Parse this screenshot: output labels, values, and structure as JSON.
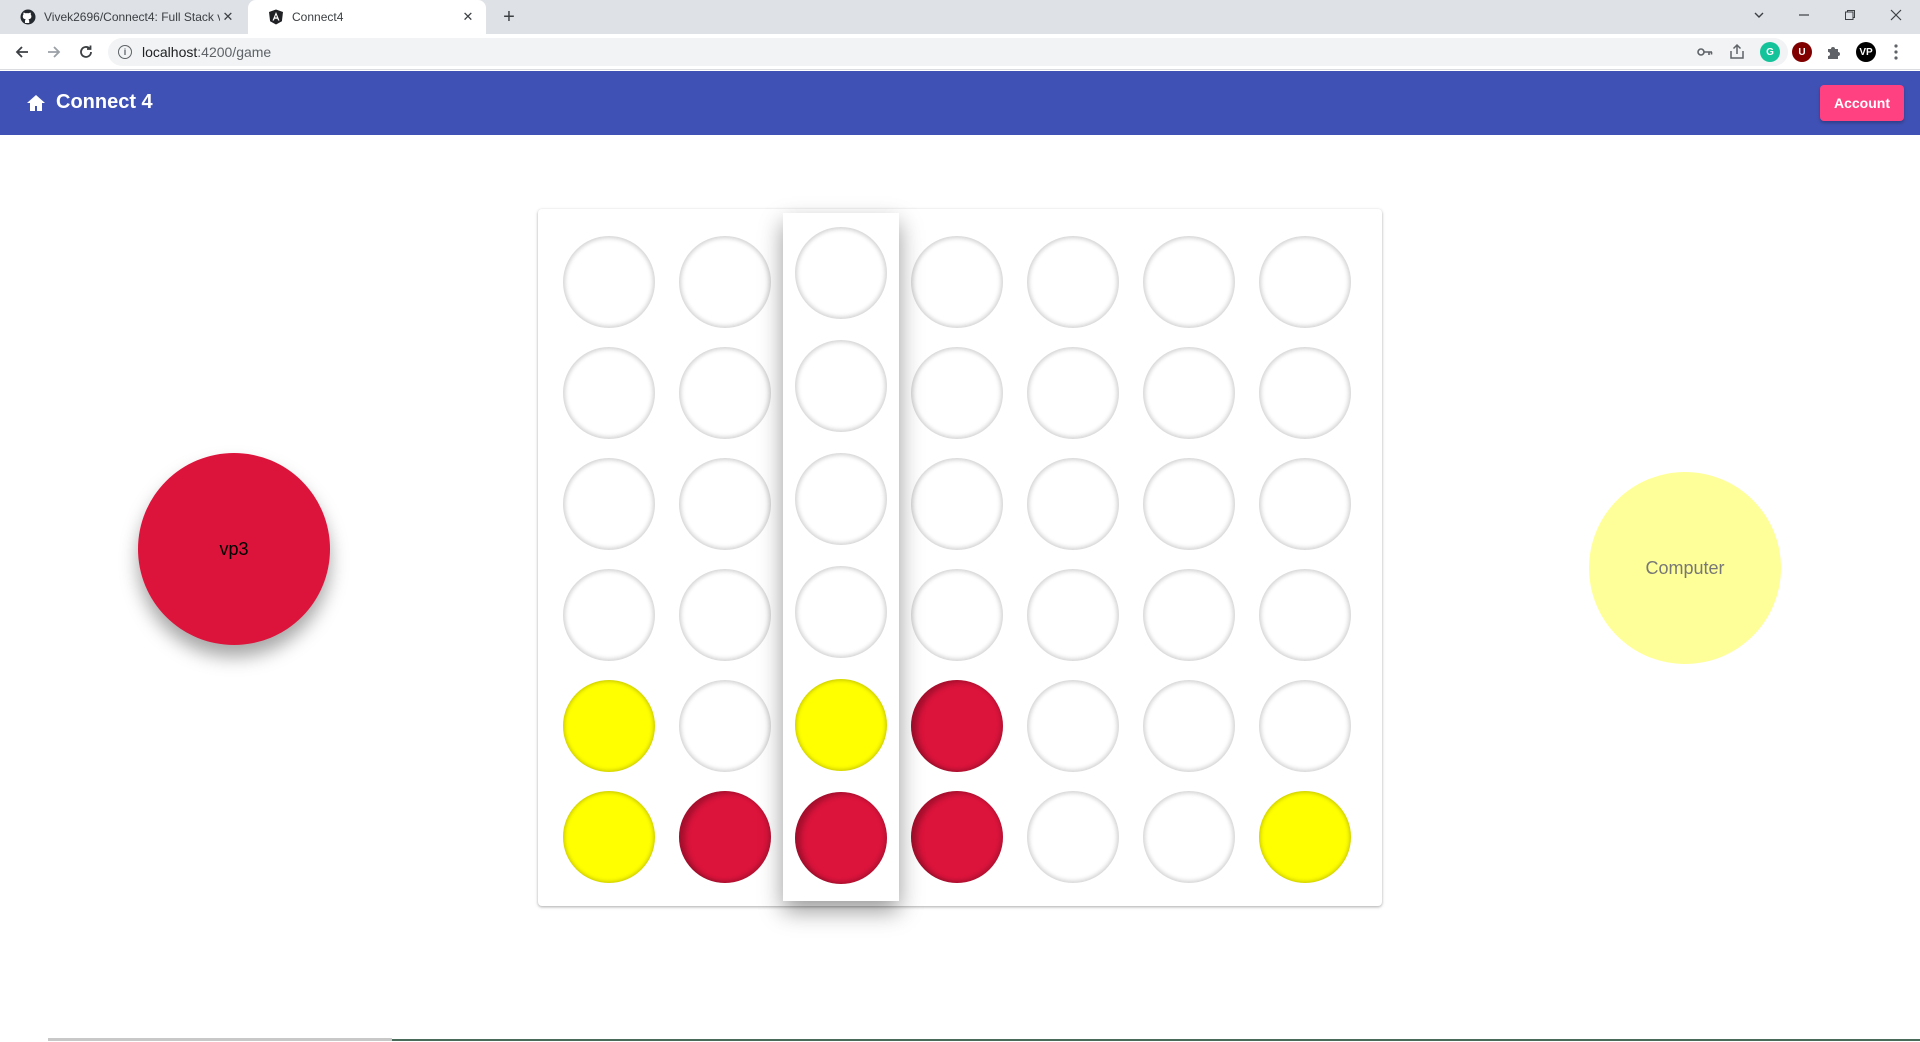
{
  "browser": {
    "tabs": [
      {
        "title": "Vivek2696/Connect4: Full Stack v",
        "icon": "github-icon",
        "active": false
      },
      {
        "title": "Connect4",
        "icon": "angular-icon",
        "active": true
      }
    ],
    "new_tab_symbol": "+",
    "url_host": "localhost",
    "url_rest": ":4200/game",
    "profile_initials": "VP",
    "ublock_letter": "U"
  },
  "appbar": {
    "title": "Connect 4",
    "account_label": "Account",
    "color": "#3f51b5",
    "accent": "#ff4081"
  },
  "players": {
    "human": {
      "name": "vp3",
      "color": "#dc143c"
    },
    "computer": {
      "name": "Computer",
      "color": "#ffff99"
    }
  },
  "board": {
    "rows": 6,
    "columns": 7,
    "hover_column": 2,
    "cells": [
      [
        "empty",
        "empty",
        "empty",
        "empty",
        "empty",
        "empty",
        "empty"
      ],
      [
        "empty",
        "empty",
        "empty",
        "empty",
        "empty",
        "empty",
        "empty"
      ],
      [
        "empty",
        "empty",
        "empty",
        "empty",
        "empty",
        "empty",
        "empty"
      ],
      [
        "empty",
        "empty",
        "empty",
        "empty",
        "empty",
        "empty",
        "empty"
      ],
      [
        "yellow",
        "empty",
        "yellow",
        "red",
        "empty",
        "empty",
        "empty"
      ],
      [
        "yellow",
        "red",
        "red",
        "red",
        "empty",
        "empty",
        "yellow"
      ]
    ]
  }
}
